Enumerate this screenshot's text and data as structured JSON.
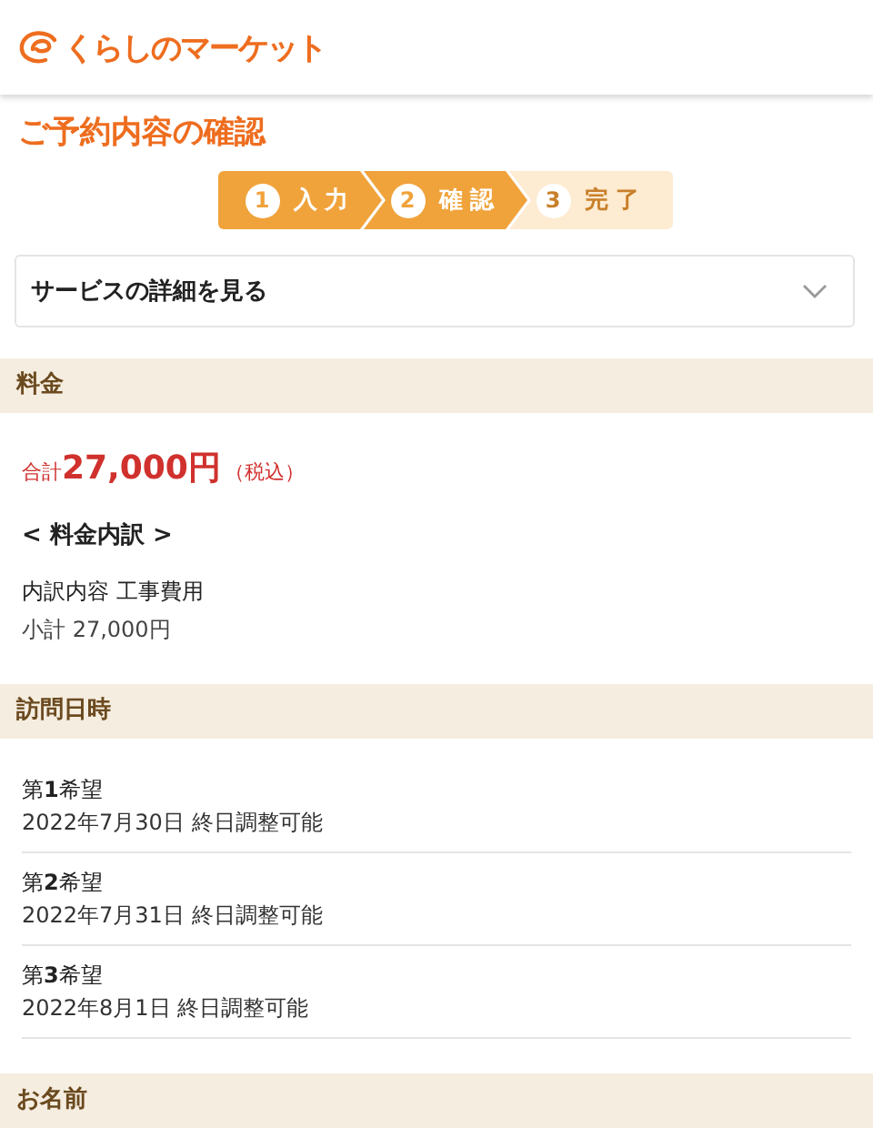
{
  "header": {
    "logo_text": "くらしのマーケット"
  },
  "page_title": "ご予約内容の確認",
  "steps": [
    {
      "number": "1",
      "label": "入力",
      "active": true
    },
    {
      "number": "2",
      "label": "確認",
      "active": true
    },
    {
      "number": "3",
      "label": "完了",
      "active": false
    }
  ],
  "accordion": {
    "label": "サービスの詳細を見る",
    "expanded": false
  },
  "sections": [
    {
      "kind": "price",
      "title": "料金",
      "total_label": "合計",
      "total": "27,000円",
      "tax_note": "（税込）",
      "breakdown_title": "< 料金内訳 >",
      "item": "内訳内容 工事費用",
      "subtotal": "小計 27,000円"
    },
    {
      "kind": "dates",
      "title": "訪問日時",
      "preferences": [
        {
          "label": "第**1**希望",
          "value": "2022年7月30日 終日調整可能"
        },
        {
          "label": "第**2**希望",
          "value": "2022年7月31日 終日調整可能"
        },
        {
          "label": "第**3**希望",
          "value": "2022年8月1日 終日調整可能"
        }
      ]
    },
    {
      "kind": "name",
      "title": "お名前"
    }
  ]
}
